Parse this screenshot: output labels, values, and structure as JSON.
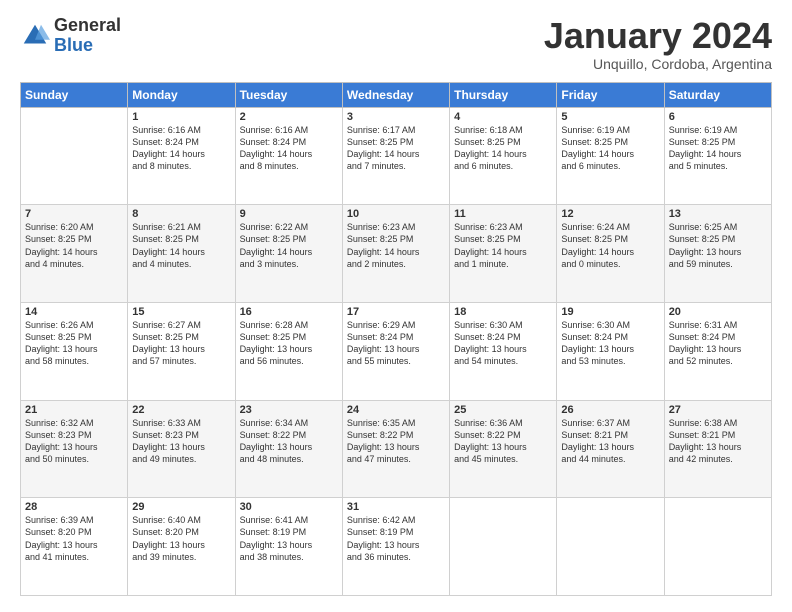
{
  "logo": {
    "general": "General",
    "blue": "Blue"
  },
  "title": "January 2024",
  "subtitle": "Unquillo, Cordoba, Argentina",
  "headers": [
    "Sunday",
    "Monday",
    "Tuesday",
    "Wednesday",
    "Thursday",
    "Friday",
    "Saturday"
  ],
  "weeks": [
    [
      {
        "day": "",
        "info": ""
      },
      {
        "day": "1",
        "info": "Sunrise: 6:16 AM\nSunset: 8:24 PM\nDaylight: 14 hours\nand 8 minutes."
      },
      {
        "day": "2",
        "info": "Sunrise: 6:16 AM\nSunset: 8:24 PM\nDaylight: 14 hours\nand 8 minutes."
      },
      {
        "day": "3",
        "info": "Sunrise: 6:17 AM\nSunset: 8:25 PM\nDaylight: 14 hours\nand 7 minutes."
      },
      {
        "day": "4",
        "info": "Sunrise: 6:18 AM\nSunset: 8:25 PM\nDaylight: 14 hours\nand 6 minutes."
      },
      {
        "day": "5",
        "info": "Sunrise: 6:19 AM\nSunset: 8:25 PM\nDaylight: 14 hours\nand 6 minutes."
      },
      {
        "day": "6",
        "info": "Sunrise: 6:19 AM\nSunset: 8:25 PM\nDaylight: 14 hours\nand 5 minutes."
      }
    ],
    [
      {
        "day": "7",
        "info": "Sunrise: 6:20 AM\nSunset: 8:25 PM\nDaylight: 14 hours\nand 4 minutes."
      },
      {
        "day": "8",
        "info": "Sunrise: 6:21 AM\nSunset: 8:25 PM\nDaylight: 14 hours\nand 4 minutes."
      },
      {
        "day": "9",
        "info": "Sunrise: 6:22 AM\nSunset: 8:25 PM\nDaylight: 14 hours\nand 3 minutes."
      },
      {
        "day": "10",
        "info": "Sunrise: 6:23 AM\nSunset: 8:25 PM\nDaylight: 14 hours\nand 2 minutes."
      },
      {
        "day": "11",
        "info": "Sunrise: 6:23 AM\nSunset: 8:25 PM\nDaylight: 14 hours\nand 1 minute."
      },
      {
        "day": "12",
        "info": "Sunrise: 6:24 AM\nSunset: 8:25 PM\nDaylight: 14 hours\nand 0 minutes."
      },
      {
        "day": "13",
        "info": "Sunrise: 6:25 AM\nSunset: 8:25 PM\nDaylight: 13 hours\nand 59 minutes."
      }
    ],
    [
      {
        "day": "14",
        "info": "Sunrise: 6:26 AM\nSunset: 8:25 PM\nDaylight: 13 hours\nand 58 minutes."
      },
      {
        "day": "15",
        "info": "Sunrise: 6:27 AM\nSunset: 8:25 PM\nDaylight: 13 hours\nand 57 minutes."
      },
      {
        "day": "16",
        "info": "Sunrise: 6:28 AM\nSunset: 8:25 PM\nDaylight: 13 hours\nand 56 minutes."
      },
      {
        "day": "17",
        "info": "Sunrise: 6:29 AM\nSunset: 8:24 PM\nDaylight: 13 hours\nand 55 minutes."
      },
      {
        "day": "18",
        "info": "Sunrise: 6:30 AM\nSunset: 8:24 PM\nDaylight: 13 hours\nand 54 minutes."
      },
      {
        "day": "19",
        "info": "Sunrise: 6:30 AM\nSunset: 8:24 PM\nDaylight: 13 hours\nand 53 minutes."
      },
      {
        "day": "20",
        "info": "Sunrise: 6:31 AM\nSunset: 8:24 PM\nDaylight: 13 hours\nand 52 minutes."
      }
    ],
    [
      {
        "day": "21",
        "info": "Sunrise: 6:32 AM\nSunset: 8:23 PM\nDaylight: 13 hours\nand 50 minutes."
      },
      {
        "day": "22",
        "info": "Sunrise: 6:33 AM\nSunset: 8:23 PM\nDaylight: 13 hours\nand 49 minutes."
      },
      {
        "day": "23",
        "info": "Sunrise: 6:34 AM\nSunset: 8:22 PM\nDaylight: 13 hours\nand 48 minutes."
      },
      {
        "day": "24",
        "info": "Sunrise: 6:35 AM\nSunset: 8:22 PM\nDaylight: 13 hours\nand 47 minutes."
      },
      {
        "day": "25",
        "info": "Sunrise: 6:36 AM\nSunset: 8:22 PM\nDaylight: 13 hours\nand 45 minutes."
      },
      {
        "day": "26",
        "info": "Sunrise: 6:37 AM\nSunset: 8:21 PM\nDaylight: 13 hours\nand 44 minutes."
      },
      {
        "day": "27",
        "info": "Sunrise: 6:38 AM\nSunset: 8:21 PM\nDaylight: 13 hours\nand 42 minutes."
      }
    ],
    [
      {
        "day": "28",
        "info": "Sunrise: 6:39 AM\nSunset: 8:20 PM\nDaylight: 13 hours\nand 41 minutes."
      },
      {
        "day": "29",
        "info": "Sunrise: 6:40 AM\nSunset: 8:20 PM\nDaylight: 13 hours\nand 39 minutes."
      },
      {
        "day": "30",
        "info": "Sunrise: 6:41 AM\nSunset: 8:19 PM\nDaylight: 13 hours\nand 38 minutes."
      },
      {
        "day": "31",
        "info": "Sunrise: 6:42 AM\nSunset: 8:19 PM\nDaylight: 13 hours\nand 36 minutes."
      },
      {
        "day": "",
        "info": ""
      },
      {
        "day": "",
        "info": ""
      },
      {
        "day": "",
        "info": ""
      }
    ]
  ]
}
